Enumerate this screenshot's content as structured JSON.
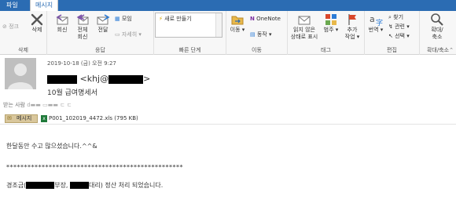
{
  "tabs": [
    {
      "label": "파일"
    },
    {
      "label": "메시지"
    }
  ],
  "ribbon": {
    "delete_group": {
      "label": "삭제",
      "junk": "정크",
      "delete": "삭제"
    },
    "respond_group": {
      "label": "응답",
      "reply": "회신",
      "reply_all_1": "전체",
      "reply_all_2": "회신",
      "forward": "전달",
      "meeting": "모임",
      "more": "자세히"
    },
    "quick_steps": {
      "label": "빠른 단계",
      "item": "새로 만들기"
    },
    "move_group": {
      "label": "이동",
      "move": "이동",
      "onenote": "OneNote",
      "actions": "동작"
    },
    "tags_group": {
      "label": "태그",
      "unread_1": "읽지 않은",
      "unread_2": "상태로 표시",
      "categorize": "범주",
      "followup_1": "추가",
      "followup_2": "작업"
    },
    "edit_group": {
      "label": "편집",
      "translate": "번역",
      "find": "찾기",
      "related": "관련",
      "select": "선택"
    },
    "zoom_group": {
      "label": "확대/축소",
      "zoom_1": "확대/",
      "zoom_2": "축소"
    }
  },
  "message": {
    "date": "2019-10-18 (금) 오전 9:27",
    "from_prefix": "<khj@",
    "from_suffix": ">",
    "subject": "10월 급여명세서",
    "to_label": "받는 사람",
    "to_value": "d▬▬ ▭▬▬ ㄷ ㄷ"
  },
  "attachments": {
    "message_tab": "메시지",
    "file": "P001_102019_4472.xls (795 KB)"
  },
  "body": {
    "line1": "한달동안 수고 많으셨습니다.^^&",
    "separator": "**************************************************",
    "line3_a": "경조금(",
    "line3_b": "부장,",
    "line3_c": "대리) 정산 처리 되었습니다."
  },
  "colors": {
    "titlebar": "#2b6cb3",
    "ribbon": "#f7f7f7",
    "delete_x": "#555555",
    "followup_flag": "#d9472b"
  },
  "icons": [
    "junk-icon",
    "delete-icon",
    "reply-icon",
    "reply-all-icon",
    "forward-icon",
    "meeting-icon",
    "more-icon",
    "quick-step-icon",
    "move-icon",
    "onenote-icon",
    "actions-icon",
    "unread-icon",
    "categorize-icon",
    "followup-icon",
    "translate-icon",
    "find-icon",
    "related-icon",
    "select-icon",
    "zoom-icon",
    "avatar-icon",
    "message-icon",
    "excel-file-icon"
  ]
}
